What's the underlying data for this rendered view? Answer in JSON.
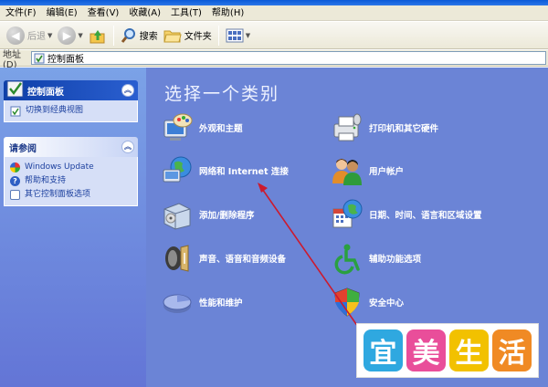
{
  "menubar": [
    "文件(F)",
    "编辑(E)",
    "查看(V)",
    "收藏(A)",
    "工具(T)",
    "帮助(H)"
  ],
  "toolbar": {
    "back": "后退",
    "search": "搜索",
    "folders": "文件夹"
  },
  "address": {
    "label": "地址(D)",
    "value": "控制面板"
  },
  "control_panel_box": {
    "title": "控制面板",
    "switch_link": "切换到经典视图"
  },
  "see_also_box": {
    "title": "请参阅",
    "links": [
      "Windows Update",
      "帮助和支持",
      "其它控制面板选项"
    ]
  },
  "main": {
    "heading": "选择一个类别",
    "categories": [
      "外观和主题",
      "打印机和其它硬件",
      "网络和 Internet 连接",
      "用户帐户",
      "添加/删除程序",
      "日期、时间、语言和区域设置",
      "声音、语音和音频设备",
      "辅助功能选项",
      "性能和维护",
      "安全中心"
    ]
  },
  "banner": [
    "宜",
    "美",
    "生",
    "活"
  ],
  "colors": {
    "pane_blue": "#6b84d6",
    "arrow_red": "#cc1a2e",
    "banner_colors": [
      "#2fa8e0",
      "#e94e9a",
      "#f2c100",
      "#f08a24"
    ]
  }
}
